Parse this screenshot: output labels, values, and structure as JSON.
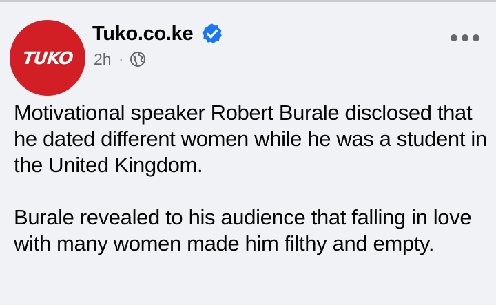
{
  "post": {
    "page_name": "Tuko.co.ke",
    "avatar_text": "TUKO",
    "timestamp": "2h",
    "separator": "·",
    "paragraphs": [
      "Motivational speaker Robert Burale disclosed that he dated different women while he was a student in the United Kingdom.",
      "Burale revealed to his audience that falling in love with many women made him filthy and empty."
    ]
  },
  "icons": {
    "verified": "verified-badge-icon",
    "audience": "globe-icon",
    "menu": "more-options-icon"
  },
  "colors": {
    "brand_red": "#d21f26",
    "verified_blue": "#1877f2",
    "background": "#f1f2f5",
    "text_primary": "#050505",
    "text_secondary": "#65676b"
  }
}
